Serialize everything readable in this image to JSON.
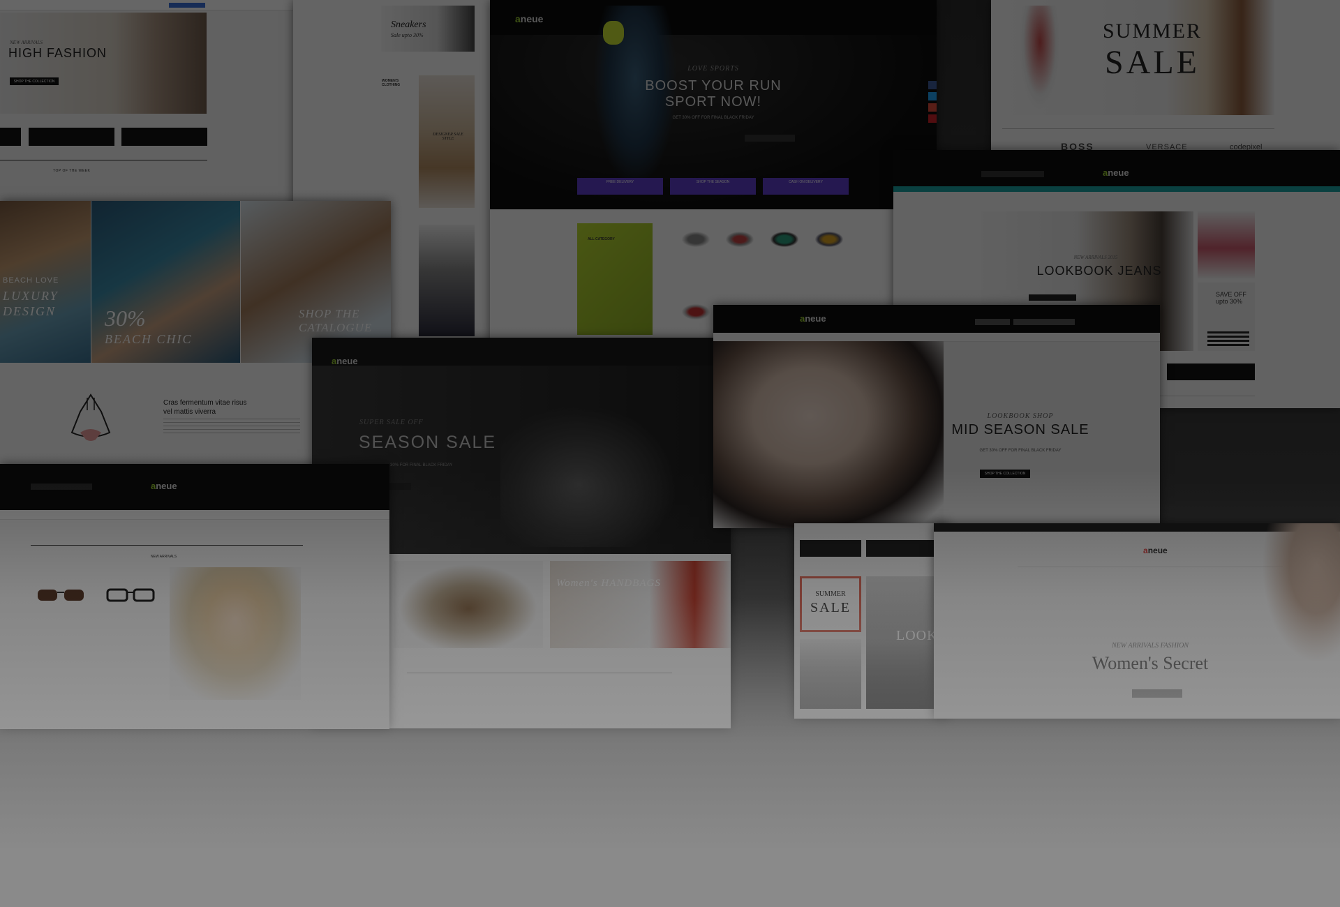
{
  "screens": {
    "high_fashion": {
      "kicker": "NEW ARRIVALS",
      "title": "HIGH FASHION",
      "sub": "SHOP THE COLLECTION"
    },
    "sneakers": {
      "title": "Sneakers",
      "sub": "Sale upto 30%",
      "cat_title": "WOMEN'S CLOTHING",
      "banner": "DESIGNER SALE STYLE"
    },
    "boost_run": {
      "kicker": "LOVE SPORTS",
      "title_line1": "BOOST YOUR RUN",
      "title_line2": "SPORT NOW!",
      "sub": "GET 30% OFF FOR FINAL BLACK FRIDAY",
      "btn1": "FREE DELIVERY",
      "btn2": "SHOP THE SEASON",
      "btn3": "CASH ON DELIVERY",
      "cat_title": "ALL CATEGORY"
    },
    "summer_sale": {
      "line1": "SUMMER",
      "line2": "SALE",
      "brand1": "BOSS",
      "brand2": "VERSACE",
      "brand3": "codepixel"
    },
    "lookbook": {
      "kicker": "NEW ARRIVALS 2015",
      "title": "LOOKBOOK JEANS",
      "side_text": "SAVE OFF upto 30%"
    },
    "beach": {
      "panel1_line1": "BEACH LOVE",
      "panel1_line2": "LUXURY",
      "panel1_line3": "DESIGN",
      "panel2_big": "30%",
      "panel2_line": "BEACH CHIC",
      "panel3_line1": "SHOP THE",
      "panel3_line2": "CATALOGUE",
      "product_title_line1": "Cras fermentum vitae risus",
      "product_title_line2": "vel mattis viverra",
      "week_title": "TOP OF THE WEEK"
    },
    "season_sale": {
      "kicker": "SUPER SALE OFF",
      "title": "SEASON SALE",
      "sub": "30% FOR FINAL BLACK FRIDAY",
      "card_title": "Women's HANDBAGS"
    },
    "mid_season": {
      "kicker": "LOOKBOOK SHOP",
      "title": "MID SEASON SALE",
      "sub": "GET 30% OFF FOR FINAL BLACK FRIDAY",
      "cta": "SHOP THE COLLECTION"
    },
    "eyewear": {
      "section_title": "NEW ARRIVALS"
    },
    "womens_secret": {
      "kicker": "NEW ARRIVALS FASHION",
      "title": "Women's Secret"
    },
    "small_sale": {
      "line1": "SUMMER",
      "line2": "SALE",
      "side": "LOOK"
    }
  },
  "brand": {
    "logo_a": "a",
    "logo_rest": "neue"
  },
  "colors": {
    "accent_green": "#9acd32",
    "purple": "#5c3cc8",
    "teal": "#19a0a0"
  }
}
